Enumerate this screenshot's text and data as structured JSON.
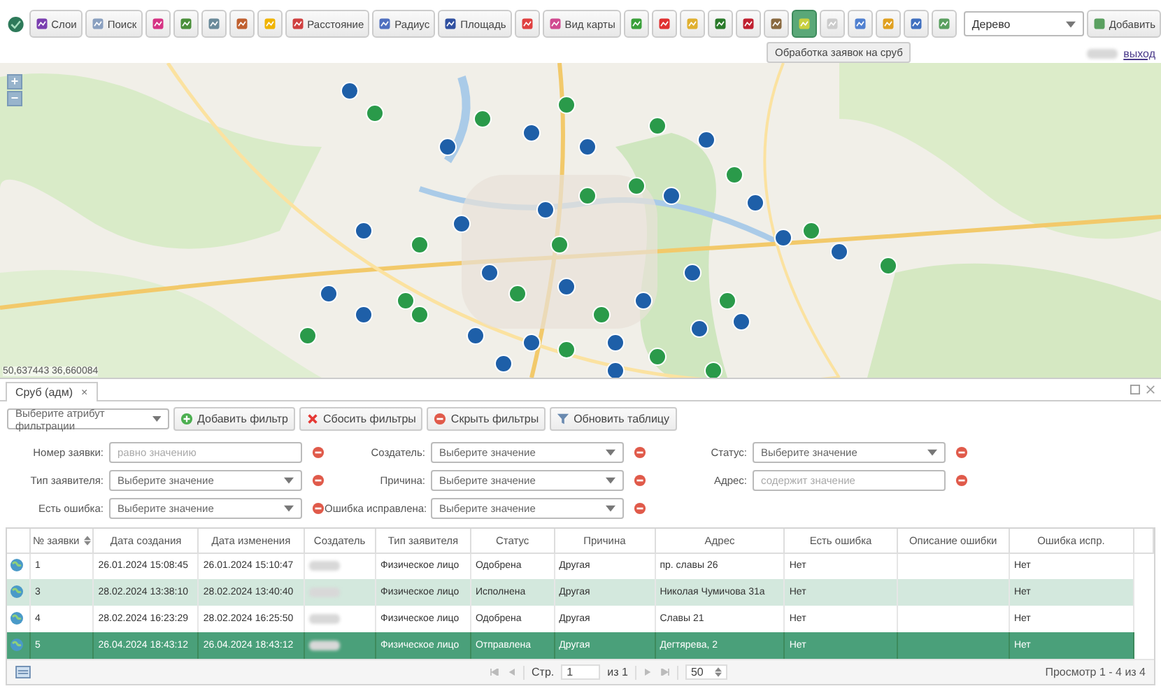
{
  "toolbar": {
    "buttons": [
      {
        "label": "Слои",
        "active": false
      },
      {
        "label": "Поиск",
        "active": false
      },
      {
        "active": false
      },
      {
        "active": false
      },
      {
        "active": false
      },
      {
        "active": false
      },
      {
        "active": false
      },
      {
        "label": "Расстояние",
        "active": false
      },
      {
        "label": "Радиус",
        "active": false
      },
      {
        "label": "Площадь",
        "active": false
      },
      {
        "active": false
      },
      {
        "label": "Вид карты",
        "active": false
      },
      {
        "active": false
      },
      {
        "active": false
      },
      {
        "active": false
      },
      {
        "active": false
      },
      {
        "active": false
      },
      {
        "active": false
      },
      {
        "active": true
      },
      {
        "active": false
      },
      {
        "active": false
      },
      {
        "active": false
      },
      {
        "active": false
      },
      {
        "active": false
      }
    ],
    "layer_select": {
      "value": "Дерево"
    },
    "add_button": {
      "label": "Добавить"
    },
    "tooltip": "Обработка заявок на сруб",
    "logout_link": "выход"
  },
  "map": {
    "zoom_in": "+",
    "zoom_out": "−",
    "coordinates": "50,637443 36,660084"
  },
  "panel": {
    "tab": {
      "label": "Сруб (адм)",
      "close": "×",
      "selected": true
    },
    "filter_bar": {
      "attribute_placeholder": "Выберите атрибут фильтрации",
      "buttons": [
        {
          "kind": "add",
          "label": "Добавить фильтр"
        },
        {
          "kind": "reset",
          "label": "Сбосить фильтры"
        },
        {
          "kind": "hide",
          "label": "Скрыть фильтры"
        },
        {
          "kind": "refresh",
          "label": "Обновить таблицу"
        }
      ]
    },
    "filters": [
      {
        "label": "Номер заявки:",
        "kind": "text",
        "placeholder": "равно значению"
      },
      {
        "label": "Создатель:",
        "kind": "select",
        "placeholder": "Выберите значение"
      },
      {
        "label": "Статус:",
        "kind": "select",
        "placeholder": "Выберите значение"
      },
      {
        "label": "Тип заявителя:",
        "kind": "select",
        "placeholder": "Выберите значение"
      },
      {
        "label": "Причина:",
        "kind": "select",
        "placeholder": "Выберите значение"
      },
      {
        "label": "Адрес:",
        "kind": "text",
        "placeholder": "содержит значение"
      },
      {
        "label": "Есть ошибка:",
        "kind": "select",
        "placeholder": "Выберите значение"
      },
      {
        "label": "Ошибка исправлена:",
        "kind": "select",
        "placeholder": "Выберите значение"
      }
    ],
    "table": {
      "columns": [
        {
          "label": "№ заявки",
          "sorted": true,
          "redacted": false
        },
        {
          "label": "Дата создания",
          "sorted": false,
          "redacted": false
        },
        {
          "label": "Дата изменения",
          "sorted": false,
          "redacted": false
        },
        {
          "label": "Создатель",
          "sorted": false,
          "redacted": true
        },
        {
          "label": "Тип заявителя",
          "sorted": false,
          "redacted": false
        },
        {
          "label": "Статус",
          "sorted": false,
          "redacted": false
        },
        {
          "label": "Причина",
          "sorted": false,
          "redacted": false
        },
        {
          "label": "Адрес",
          "sorted": false,
          "redacted": false
        },
        {
          "label": "Есть ошибка",
          "sorted": false,
          "redacted": false
        },
        {
          "label": "Описание ошибки",
          "sorted": false,
          "redacted": false
        },
        {
          "label": "Ошибка испр.",
          "sorted": false,
          "redacted": false
        }
      ],
      "rows": [
        {
          "selected": false,
          "hovered": false,
          "cells": [
            "1",
            "26.01.2024 15:08:45",
            "26.01.2024 15:10:47",
            null,
            "Физическое лицо",
            "Одобрена",
            "Другая",
            "пр. славы 26",
            "Нет",
            null,
            "Нет"
          ]
        },
        {
          "selected": false,
          "hovered": true,
          "cells": [
            "3",
            "28.02.2024 13:38:10",
            "28.02.2024 13:40:40",
            null,
            "Физическое лицо",
            "Исполнена",
            "Другая",
            "Николая Чумичова 31а",
            "Нет",
            null,
            "Нет"
          ]
        },
        {
          "selected": false,
          "hovered": false,
          "cells": [
            "4",
            "28.02.2024 16:23:29",
            "28.02.2024 16:25:50",
            null,
            "Физическое лицо",
            "Одобрена",
            "Другая",
            "Славы 21",
            "Нет",
            null,
            "Нет"
          ]
        },
        {
          "selected": true,
          "hovered": false,
          "cells": [
            "5",
            "26.04.2024 18:43:12",
            "26.04.2024 18:43:12",
            null,
            "Физическое лицо",
            "Отправлена",
            "Другая",
            "Дегтярева, 2",
            "Нет",
            null,
            "Нет"
          ]
        }
      ]
    },
    "pager": {
      "page_label": "Стр.",
      "page": "1",
      "of": "из 1",
      "page_size": "50",
      "summary": "Просмотр 1 - 4 из 4"
    }
  }
}
